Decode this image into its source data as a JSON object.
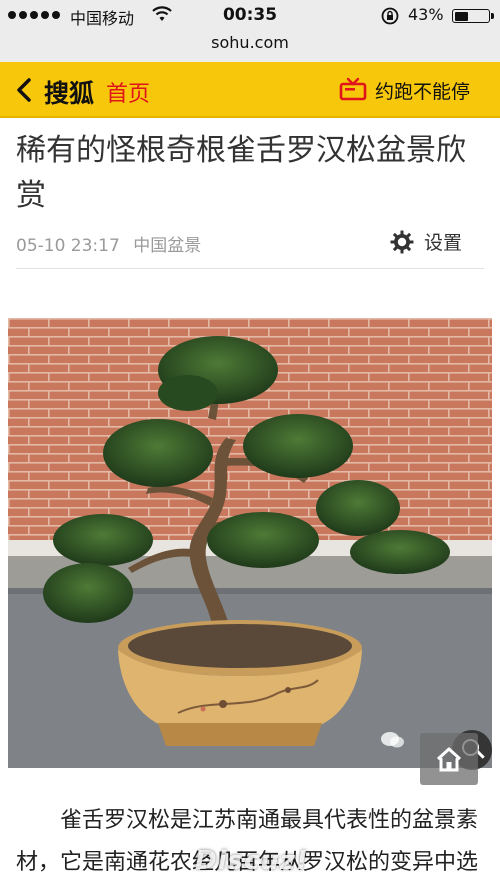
{
  "status_bar": {
    "carrier": "中国移动",
    "time": "00:35",
    "battery_percent": "43%",
    "battery_level": 0.43
  },
  "browser": {
    "url": "sohu.com"
  },
  "header": {
    "brand": "搜狐",
    "home_link": "首页",
    "promo": "约跑不能停"
  },
  "article": {
    "title": "稀有的怪根奇根雀舌罗汉松盆景欣赏",
    "date": "05-10 23:17",
    "source": "中国盆景",
    "settings_label": "设置",
    "paragraph": "雀舌罗汉松是江苏南通最具代表性的盆景素材，它是南通花农经几百年从罗汉松的变异中选育出来的，宝在南通往最大"
  },
  "overlay": {
    "watermark": "Discuz!"
  },
  "colors": {
    "header_bg": "#f7c70b",
    "home_red": "#e0141b",
    "meta_gray": "#9a9a9a"
  },
  "icons": [
    "back-chevron-icon",
    "tv-icon",
    "settings-gear-icon",
    "search-icon",
    "home-icon",
    "wechat-icon",
    "wifi-icon",
    "orientation-lock-icon"
  ]
}
